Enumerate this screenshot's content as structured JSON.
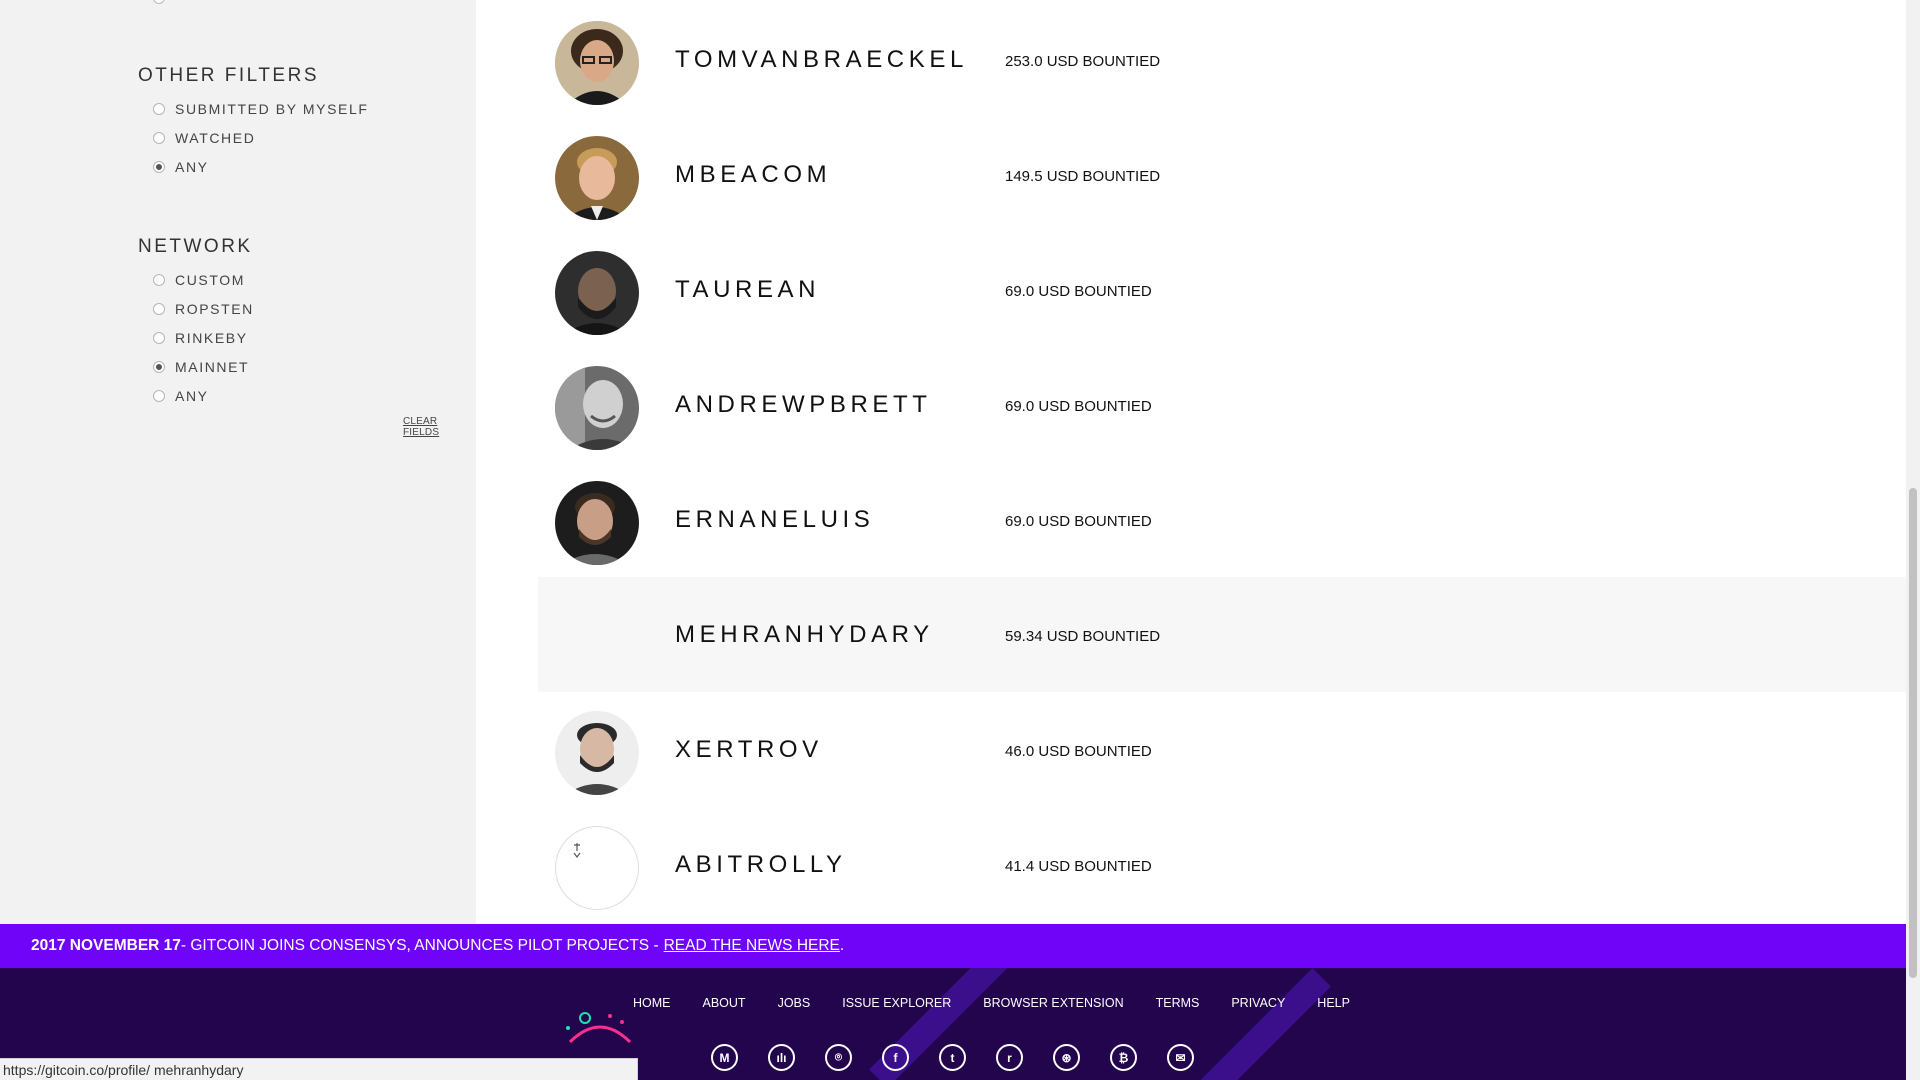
{
  "sidebar": {
    "other_filters": {
      "title": "OTHER FILTERS",
      "options": [
        {
          "label": "SUBMITTED BY MYSELF",
          "checked": false
        },
        {
          "label": "WATCHED",
          "checked": false
        },
        {
          "label": "ANY",
          "checked": true
        }
      ]
    },
    "network": {
      "title": "NETWORK",
      "options": [
        {
          "label": "CUSTOM",
          "checked": false
        },
        {
          "label": "ROPSTEN",
          "checked": false
        },
        {
          "label": "RINKEBY",
          "checked": false
        },
        {
          "label": "MAINNET",
          "checked": true
        },
        {
          "label": "ANY",
          "checked": false
        }
      ]
    },
    "clear_fields": "CLEAR FIELDS"
  },
  "leaderboard": [
    {
      "username": "TOMVANBRAECKEL",
      "amount": "253.0 USD BOUNTIED"
    },
    {
      "username": "MBEACOM",
      "amount": "149.5 USD BOUNTIED"
    },
    {
      "username": "TAUREAN",
      "amount": "69.0 USD BOUNTIED"
    },
    {
      "username": "ANDREWPBRETT",
      "amount": "69.0 USD BOUNTIED"
    },
    {
      "username": "ERNANELUIS",
      "amount": "69.0 USD BOUNTIED"
    },
    {
      "username": "MEHRANHYDARY",
      "amount": "59.34 USD BOUNTIED"
    },
    {
      "username": "XERTROV",
      "amount": "46.0 USD BOUNTIED"
    },
    {
      "username": "ABITROLLY",
      "amount": "41.4 USD BOUNTIED"
    }
  ],
  "news": {
    "date": "2017 NOVEMBER 17",
    "text": "- GITCOIN JOINS CONSENSYS, ANNOUNCES PILOT PROJECTS -",
    "link": "READ THE NEWS HERE",
    "tail": "."
  },
  "footer": {
    "nav": [
      "HOME",
      "ABOUT",
      "JOBS",
      "ISSUE EXPLORER",
      "BROWSER EXTENSION",
      "TERMS",
      "PRIVACY",
      "HELP"
    ],
    "social_icons": [
      "medium-icon",
      "podcast-icon",
      "github-icon",
      "facebook-icon",
      "twitter-icon",
      "reddit-icon",
      "slack-icon",
      "bitcoin-icon",
      "email-icon"
    ],
    "social_glyphs": [
      "M",
      "ılı",
      "⌾",
      "f",
      "t",
      "r",
      "⊛",
      "₿",
      "✉"
    ]
  },
  "status_bar": {
    "url": "https://gitcoin.co/profile/ mehranhydary"
  },
  "colors": {
    "news_bar": "#6f04f9",
    "footer_bg": "#22054d"
  }
}
